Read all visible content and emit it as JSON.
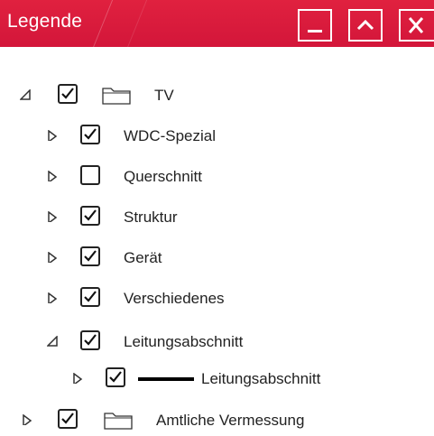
{
  "window": {
    "title": "Legende",
    "accent_color": "#d9183b",
    "buttons": {
      "minimize": "minimize-icon",
      "maximize": "chevron-up-icon",
      "close": "close-icon"
    }
  },
  "tree": {
    "items": [
      {
        "label": "TV",
        "checked": true,
        "expanded": true,
        "icon": "folder-icon"
      },
      {
        "label": "WDC-Spezial",
        "checked": true,
        "expanded": false
      },
      {
        "label": "Querschnitt",
        "checked": false,
        "expanded": false
      },
      {
        "label": "Struktur",
        "checked": true,
        "expanded": false
      },
      {
        "label": "Gerät",
        "checked": true,
        "expanded": false
      },
      {
        "label": "Verschiedenes",
        "checked": true,
        "expanded": false
      },
      {
        "label": "Leitungsabschnitt",
        "checked": true,
        "expanded": true
      },
      {
        "label": "Leitungsabschnitt",
        "checked": true,
        "expanded": false,
        "icon": "line-symbol-icon"
      },
      {
        "label": "Amtliche Vermessung",
        "checked": true,
        "expanded": false,
        "icon": "folder-icon"
      }
    ]
  }
}
